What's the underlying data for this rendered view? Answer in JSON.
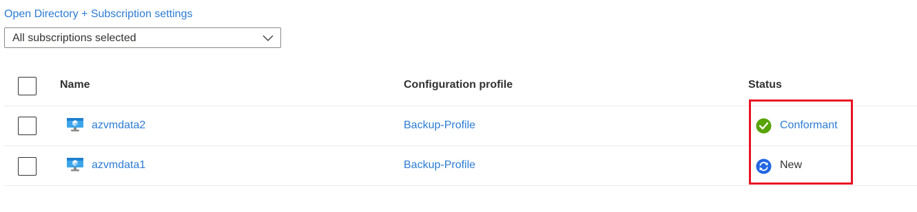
{
  "header": {
    "directory_link": "Open Directory + Subscription settings",
    "subscription_select": {
      "value": "All subscriptions selected"
    }
  },
  "table": {
    "columns": {
      "name": "Name",
      "profile": "Configuration profile",
      "status": "Status"
    },
    "rows": [
      {
        "name": "azvmdata2",
        "profile": "Backup-Profile",
        "status": "Conformant",
        "status_icon": "check-circle-icon",
        "status_color": "#57a300"
      },
      {
        "name": "azvmdata1",
        "profile": "Backup-Profile",
        "status": "New",
        "status_icon": "refresh-circle-icon",
        "status_color": "#2266e3"
      }
    ]
  },
  "colors": {
    "link": "#2b7bd3",
    "highlight": "#e81123",
    "vm_icon": "#3ea5ea"
  },
  "icons": {
    "vm": "virtual-machine-icon",
    "dropdown": "chevron-down-icon"
  }
}
